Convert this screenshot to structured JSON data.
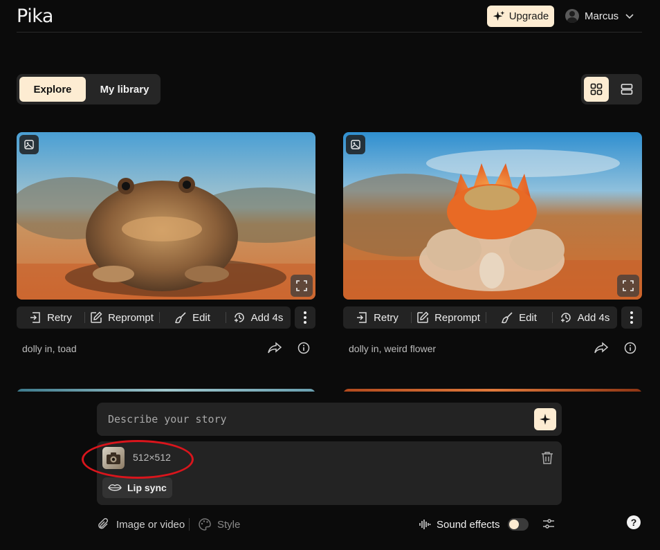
{
  "app": {
    "logo": "Pika"
  },
  "header": {
    "upgrade_label": "Upgrade",
    "user_name": "Marcus"
  },
  "tabs": [
    {
      "label": "Explore",
      "active": true
    },
    {
      "label": "My library",
      "active": false
    }
  ],
  "cards": [
    {
      "caption": "dolly in, toad",
      "actions": {
        "retry": "Retry",
        "reprompt": "Reprompt",
        "edit": "Edit",
        "add": "Add 4s"
      }
    },
    {
      "caption": "dolly in, weird flower",
      "actions": {
        "retry": "Retry",
        "reprompt": "Reprompt",
        "edit": "Edit",
        "add": "Add 4s"
      }
    }
  ],
  "composer": {
    "placeholder": "Describe your story",
    "attachment_size": "512×512",
    "lip_sync_label": "Lip sync",
    "image_or_video_label": "Image or video",
    "style_label": "Style",
    "sound_effects_label": "Sound effects",
    "sound_effects_on": false
  },
  "help_label": "?",
  "colors": {
    "accent": "#fdecd2",
    "background": "#0b0b0b",
    "panel": "#232323",
    "highlight_ring": "#d9151c"
  }
}
